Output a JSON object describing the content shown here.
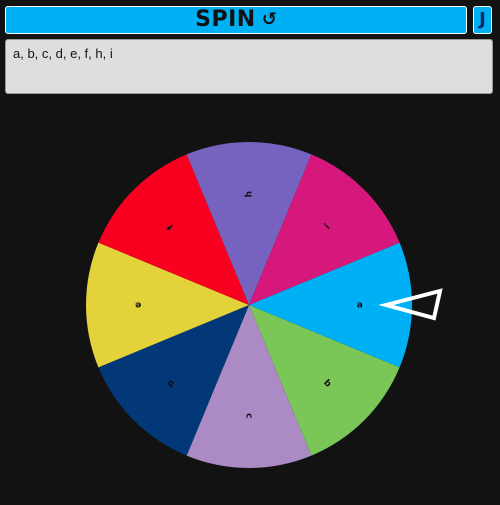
{
  "spin_button": {
    "label": "SPIN",
    "icon_glyph": "↺",
    "icon": "rotate-ccw-icon",
    "color": "#00b0f4"
  },
  "side_button": {
    "icon_glyph": "J",
    "icon": "j-hook-icon"
  },
  "options_input": {
    "value": "a, b, c, d, e, f, h, i"
  },
  "wheel": {
    "segments": [
      {
        "label": "a",
        "color": "#00b0f4"
      },
      {
        "label": "b",
        "color": "#7ac656"
      },
      {
        "label": "c",
        "color": "#ac8ac4"
      },
      {
        "label": "d",
        "color": "#033878"
      },
      {
        "label": "e",
        "color": "#e4d23a"
      },
      {
        "label": "f",
        "color": "#fa0020"
      },
      {
        "label": "h",
        "color": "#7663bf"
      },
      {
        "label": "i",
        "color": "#d6177b"
      }
    ],
    "pointer": "wedge-pointer",
    "pointer_color": "#ffffff"
  }
}
